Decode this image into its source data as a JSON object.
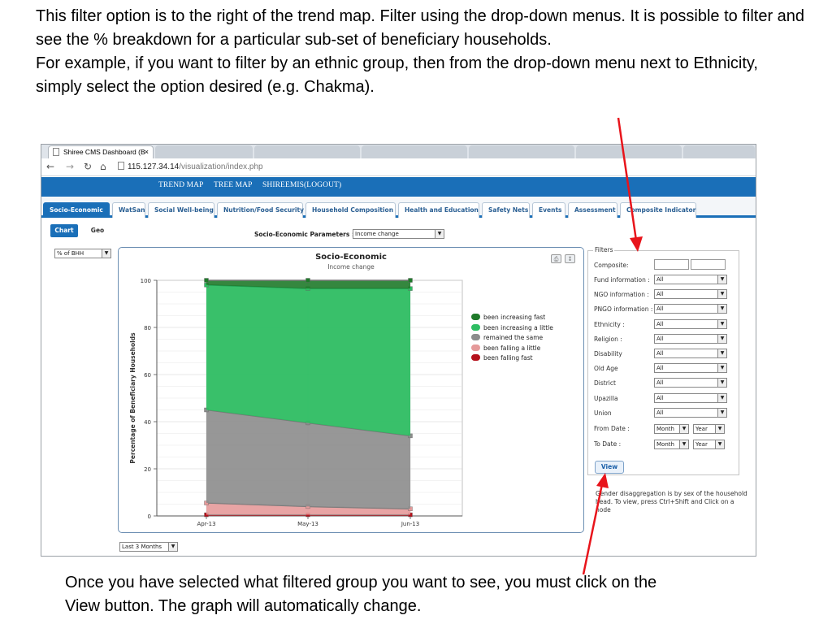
{
  "captions": {
    "top": "This filter option is to the right of the trend map. Filter using the drop-down menus. It is possible to filter and see the % breakdown for a particular sub-set of beneficiary households.\nFor example, if you want to filter by an ethnic group, then from the drop-down menu next to Ethnicity, simply select the option desired (e.g. Chakma).",
    "bottom": "Once you have selected what filtered group you want to see, you must click on the View button. The graph will automatically change."
  },
  "browser": {
    "tab_title": "Shiree CMS Dashboard (B",
    "tab_close": "×",
    "url_host": "115.127.34.14",
    "url_path": "/visualization/index.php"
  },
  "topnav": [
    "TREND MAP",
    "TREE MAP",
    "SHIREEMIS(LOGOUT)"
  ],
  "main_tabs": [
    "Socio-Economic",
    "WatSan",
    "Social Well-being",
    "Nutrition/Food Security",
    "Household Composition",
    "Health and Education",
    "Safety Nets",
    "Events",
    "Assessment",
    "Composite Indicator"
  ],
  "sub_tabs": [
    "Chart",
    "Geo"
  ],
  "params": {
    "label": "Socio-Economic Parameters :",
    "selected": "Income change"
  },
  "measure_select": "% of BHH",
  "period_select": "Last 3 Months",
  "chart_data": {
    "type": "area",
    "title": "Socio-Economic",
    "subtitle": "Income change",
    "ylabel": "Percentage of Beneficiary Households",
    "xlabel": "",
    "ylim": [
      0,
      100
    ],
    "y_ticks": [
      "0",
      "20",
      "40",
      "60",
      "80",
      "100"
    ],
    "categories": [
      "Apr-13",
      "May-13",
      "Jun-13"
    ],
    "stacked": true,
    "grid": true,
    "legend_position": "right",
    "series": [
      {
        "name": "been falling fast",
        "color": "#b5111b",
        "values": [
          0.5,
          0.5,
          0.5
        ]
      },
      {
        "name": "been falling a little",
        "color": "#e59a9a",
        "values": [
          5,
          3.5,
          2.5
        ]
      },
      {
        "name": "remained the same",
        "color": "#8c8c8c",
        "values": [
          39.5,
          35.5,
          31
        ]
      },
      {
        "name": "been increasing a little",
        "color": "#2ebd62",
        "values": [
          53,
          57,
          62.5
        ]
      },
      {
        "name": "been increasing fast",
        "color": "#1f7a2a",
        "values": [
          2,
          3.5,
          3.5
        ]
      }
    ],
    "legend_order": [
      "been increasing fast",
      "been increasing a little",
      "remained the same",
      "been falling a little",
      "been falling fast"
    ]
  },
  "filters": {
    "legend": "Filters",
    "composite_label": "Composite:",
    "rows": [
      {
        "label": "Fund information :",
        "value": "All"
      },
      {
        "label": "NGO information :",
        "value": "All"
      },
      {
        "label": "PNGO information :",
        "value": "All"
      },
      {
        "label": "Ethnicity :",
        "value": "All"
      },
      {
        "label": "Religion :",
        "value": "All"
      },
      {
        "label": "Disability",
        "value": "All"
      },
      {
        "label": "Old Age",
        "value": "All"
      },
      {
        "label": "District",
        "value": "All"
      },
      {
        "label": "Upazilla",
        "value": "All"
      },
      {
        "label": "Union",
        "value": "All"
      }
    ],
    "from_label": "From Date :",
    "to_label": "To Date :",
    "month": "Month",
    "year": "Year",
    "view_label": "View",
    "note": "Gender disaggregation is by sex of the household head. To view, press Ctrl+Shift and Click on a node"
  },
  "colors": {
    "accent": "#1a6fb8",
    "arrow": "#e8141b"
  }
}
